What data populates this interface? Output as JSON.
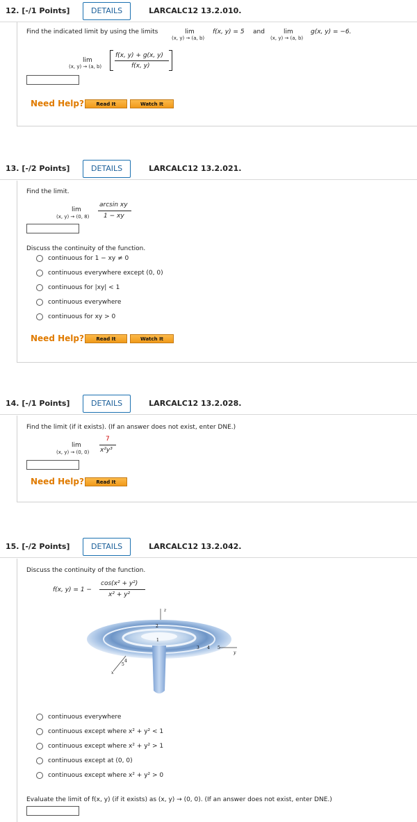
{
  "q12": {
    "points": "12. [-/1 Points]",
    "details": "DETAILS",
    "ref": "LARCALC12 13.2.010.",
    "prompt": "Find the indicated limit by using the limits",
    "lim1": "lim",
    "sub1": "(x, y) → (a, b)",
    "expr1": "f(x, y) = 5",
    "and": "and",
    "lim2": "lim",
    "sub2": "(x, y) → (a, b)",
    "expr2": "g(x, y) = −6.",
    "lim3": "lim",
    "sub3": "(x, y) → (a, b)",
    "num": "f(x, y) + g(x, y)",
    "den": "f(x, y)",
    "need_help": "Need Help?",
    "read_it": "Read It",
    "watch_it": "Watch It"
  },
  "q13": {
    "points": "13. [-/2 Points]",
    "details": "DETAILS",
    "ref": "LARCALC12 13.2.021.",
    "prompt": "Find the limit.",
    "lim": "lim",
    "sub": "(x, y) → (0, 8)",
    "num": "arcsin xy",
    "den": "1 − xy",
    "discuss": "Discuss the continuity of the function.",
    "options": [
      "continuous for 1 − xy ≠ 0",
      "continuous everywhere except (0, 0)",
      "continuous for |xy| < 1",
      "continuous everywhere",
      "continuous for xy > 0"
    ],
    "need_help": "Need Help?",
    "read_it": "Read It",
    "watch_it": "Watch It"
  },
  "q14": {
    "points": "14. [-/1 Points]",
    "details": "DETAILS",
    "ref": "LARCALC12 13.2.028.",
    "prompt": "Find the limit (if it exists). (If an answer does not exist, enter DNE.)",
    "lim": "lim",
    "sub": "(x, y) → (0, 0)",
    "num": "7",
    "den": "x²y³",
    "need_help": "Need Help?",
    "read_it": "Read It"
  },
  "q15": {
    "points": "15. [-/2 Points]",
    "details": "DETAILS",
    "ref": "LARCALC12 13.2.042.",
    "discuss": "Discuss the continuity of the function.",
    "fx": "f(x, y) = 1 −",
    "num": "cos(x² + y²)",
    "den": "x² + y²",
    "axis_z": "z",
    "tick_2": "2",
    "tick_1": "1",
    "tick_3": "3",
    "tick_4y": "4",
    "tick_5y": "5",
    "axis_y": "y",
    "tick_5x": "5",
    "tick_4x": "4",
    "axis_x": "x",
    "options": [
      "continuous everywhere",
      "continuous except where x² + y² < 1",
      "continuous except where x² + y² > 1",
      "continuous except at (0, 0)",
      "continuous except where x² + y² > 0"
    ],
    "evaluate": "Evaluate the limit of f(x, y) (if it exists) as (x, y) → (0, 0). (If an answer does not exist, enter DNE.)"
  }
}
